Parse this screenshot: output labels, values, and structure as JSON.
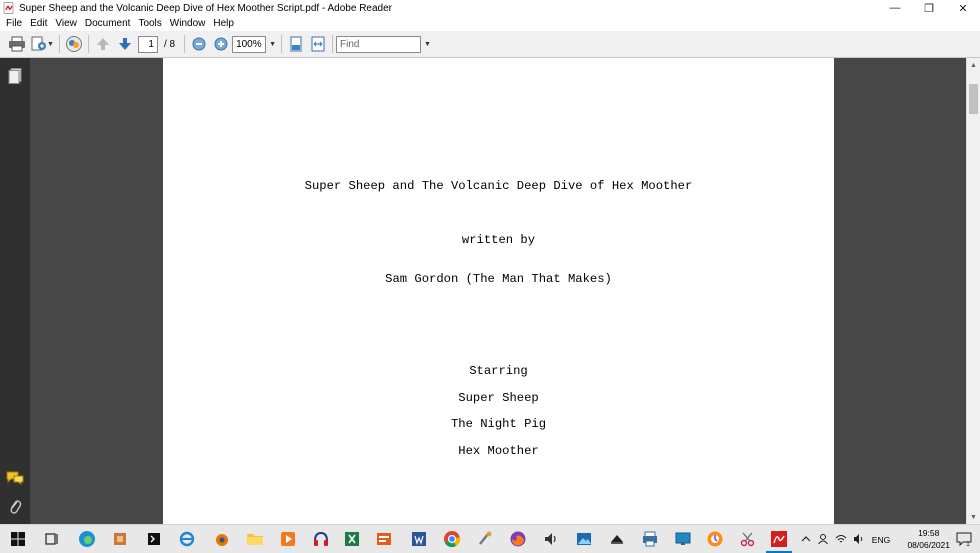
{
  "window": {
    "title": "Super Sheep and the Volcanic Deep Dive of Hex Moother Script.pdf - Adobe Reader",
    "minimize": "—",
    "restore": "❐",
    "close": "✕"
  },
  "menu": [
    "File",
    "Edit",
    "View",
    "Document",
    "Tools",
    "Window",
    "Help"
  ],
  "toolbar": {
    "page_current": "1",
    "page_total": "/ 8",
    "zoom": "100%",
    "find_placeholder": "Find"
  },
  "document": {
    "title_line": "Super Sheep and The Volcanic Deep Dive of Hex Moother",
    "written_by": "written by",
    "author": "Sam Gordon (The Man That Makes)",
    "starring_label": "Starring",
    "cast": [
      "Super Sheep",
      "The Night Pig",
      "Hex Moother"
    ]
  },
  "taskbar": {
    "language": "ENG",
    "time": "19:58",
    "date": "08/06/2021",
    "notification_count": "1"
  },
  "colors": {
    "accent": "#0078d4",
    "reader_red": "#d71e1e",
    "doc_background": "#474747",
    "side_panel": "#303030"
  }
}
